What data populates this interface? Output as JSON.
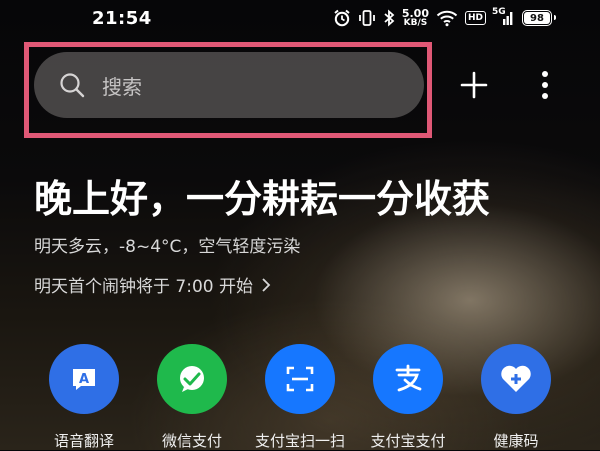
{
  "status_bar": {
    "time": "21:54",
    "net_speed_value": "5.00",
    "net_speed_unit": "KB/S",
    "hd_badge": "HD",
    "signal_type": "5G",
    "battery_level": "98"
  },
  "search": {
    "placeholder": "搜索"
  },
  "greeting": {
    "headline": "晚上好，一分耕耘一分收获",
    "weather": "明天多云，-8~4°C，空气轻度污染",
    "alarm": "明天首个闹钟将于 7:00 开始"
  },
  "shortcuts": [
    {
      "label": "语音翻译",
      "icon": "translate-icon",
      "color": "#2f6fe6"
    },
    {
      "label": "微信支付",
      "icon": "wechat-pay-icon",
      "color": "#1fb94c"
    },
    {
      "label": "支付宝扫一扫",
      "icon": "scan-icon",
      "color": "#1677ff"
    },
    {
      "label": "支付宝支付",
      "icon": "alipay-icon",
      "color": "#1677ff"
    },
    {
      "label": "健康码",
      "icon": "health-code-icon",
      "color": "#2f6fe6"
    }
  ],
  "colors": {
    "highlight_frame": "#e05876",
    "search_bg": "#4e4c4c"
  }
}
